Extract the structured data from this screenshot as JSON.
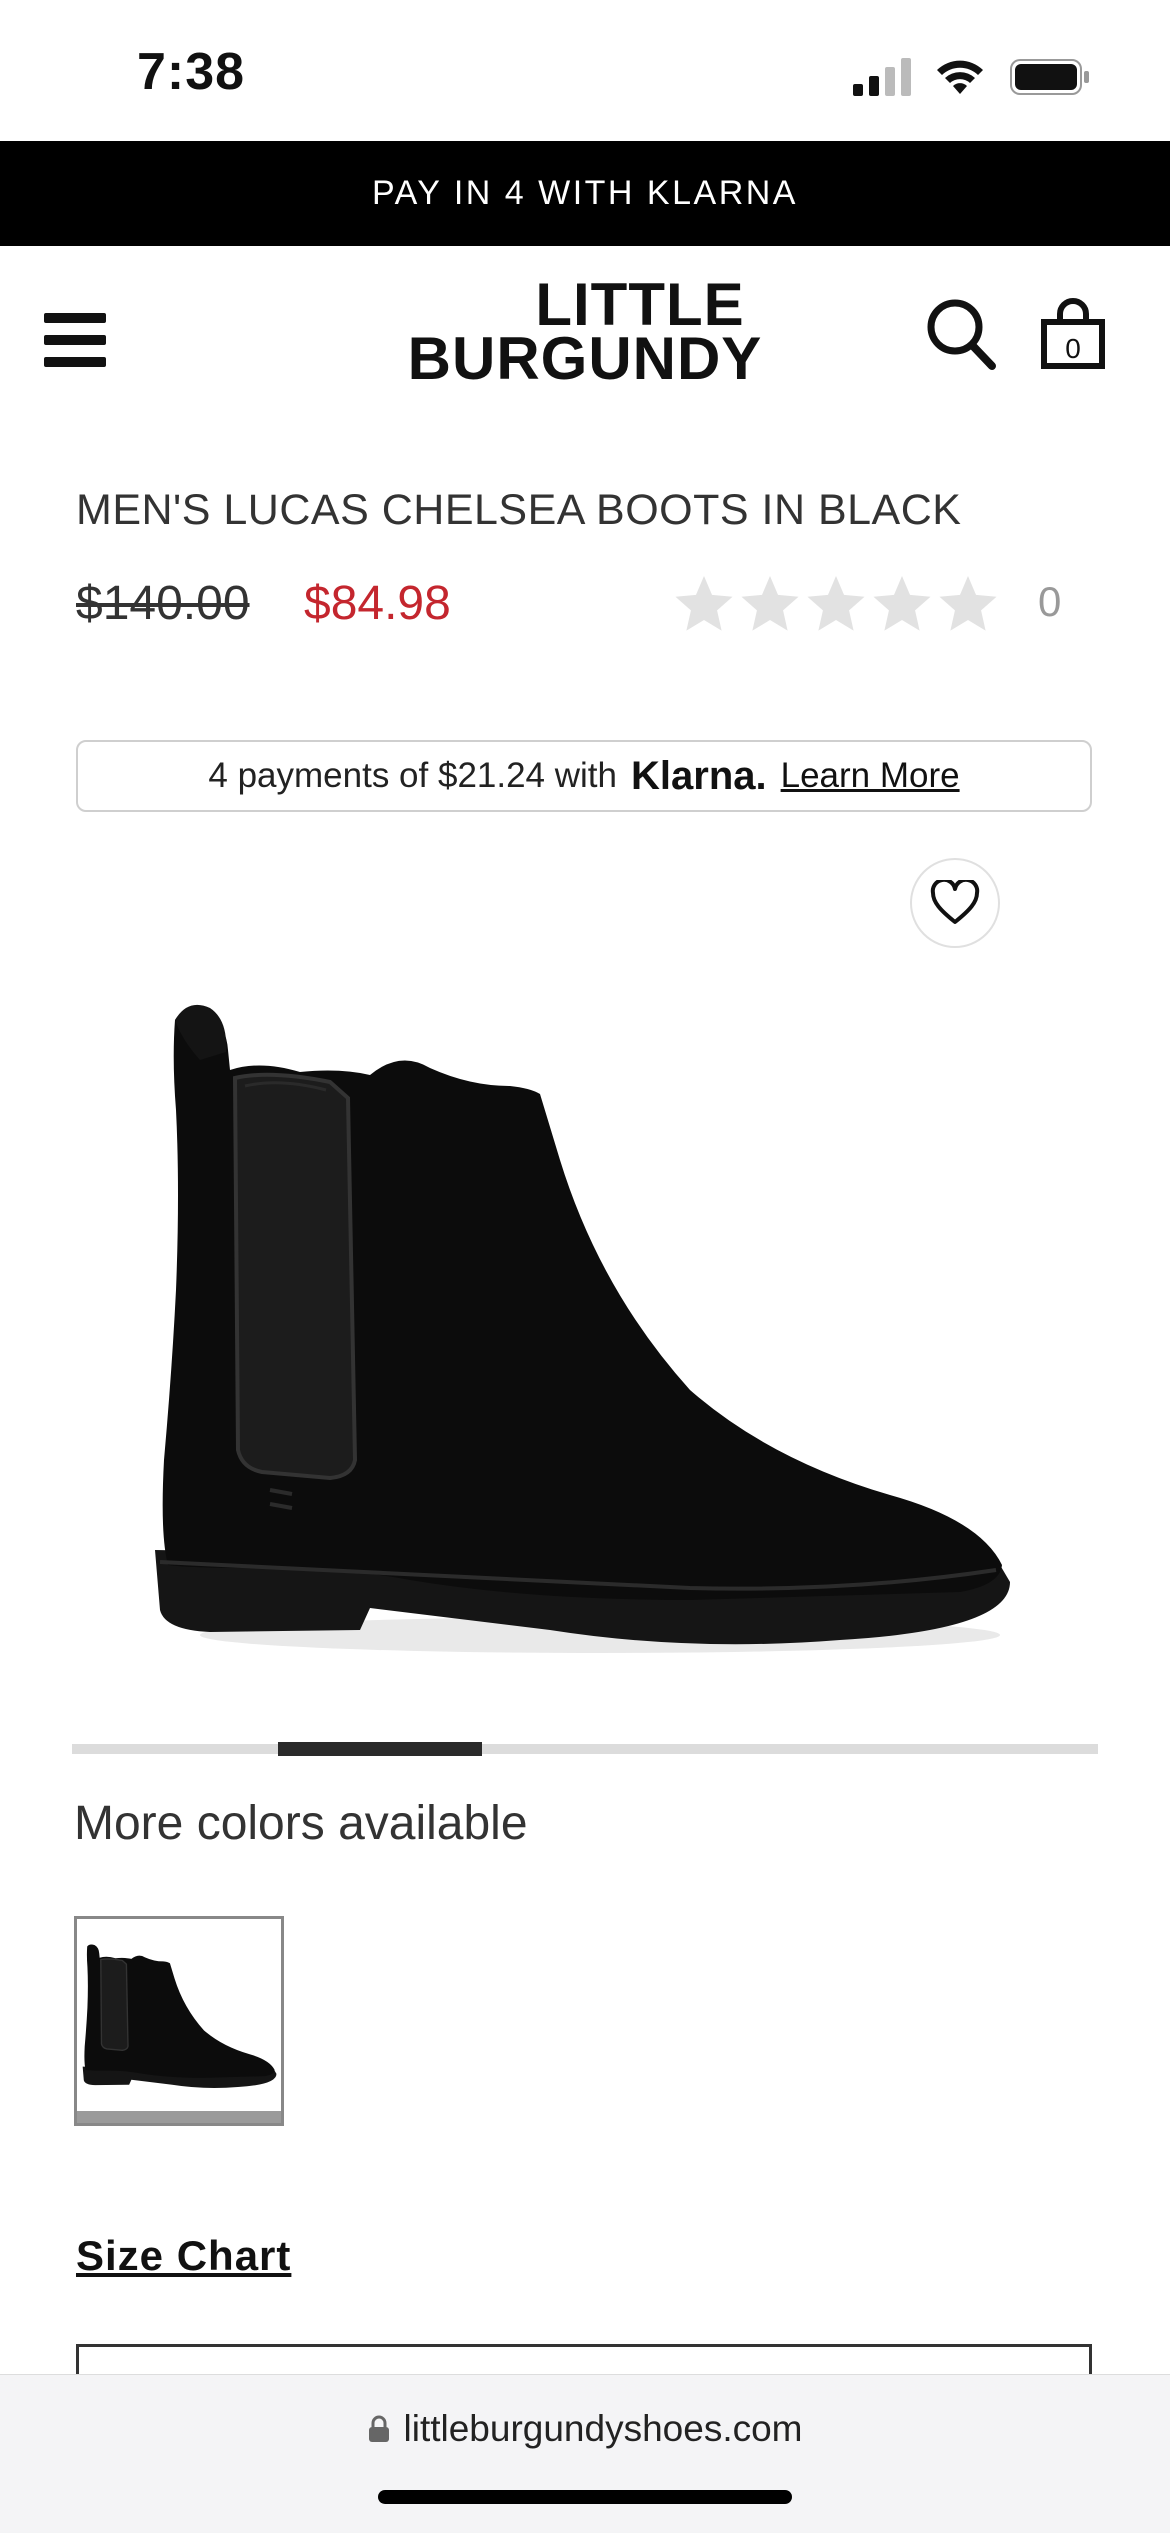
{
  "status_bar": {
    "time": "7:38"
  },
  "promo_bar": {
    "text": "PAY IN 4 WITH KLARNA"
  },
  "header": {
    "logo_line1": "LITTLE",
    "logo_line2": "BURGUNDY",
    "cart_count": "0"
  },
  "product": {
    "title": "MEN'S LUCAS CHELSEA BOOTS IN BLACK",
    "original_price": "$140.00",
    "sale_price": "$84.98",
    "rating_value": 0,
    "rating_max": 5,
    "review_count": "0"
  },
  "klarna": {
    "prefix": "4 payments of $21.24 with",
    "brand": "Klarna.",
    "link": "Learn More"
  },
  "carousel": {
    "active_index": 2,
    "total": 8
  },
  "colors": {
    "label": "More colors available"
  },
  "size_chart": {
    "label": "Size Chart"
  },
  "browser": {
    "url": "littleburgundyshoes.com"
  },
  "theme": {
    "sale_color": "#c4262e",
    "star_color": "#e2e2e2",
    "promo_bg": "#000000"
  }
}
